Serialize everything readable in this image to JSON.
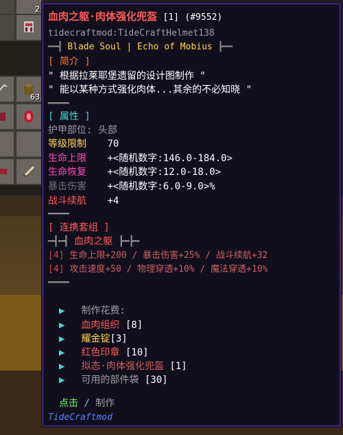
{
  "item": {
    "name": "血肉之躯·肉体强化兜盔",
    "count": "[1]",
    "id": "(#9552)",
    "registry_id": "tidecraftmod:TideCraftHelmet138",
    "series_left": "━━┫",
    "series": "Blade Soul | Echo of Mobius",
    "series_right": "┣━━"
  },
  "intro": {
    "header": "[ 简介 ]",
    "lines": [
      "\" 根据拉莱耶堡遗留的设计图制作 \"",
      "\" 能以某种方式强化肉体...其余的不必知晓 \""
    ],
    "divider": "━━━━"
  },
  "attributes": {
    "header": "[ 属性 ]",
    "slot_label": "护甲部位: 头部",
    "level_label": "等级限制",
    "level_value": "70",
    "stats": [
      {
        "label": "生命上限",
        "value": "+<随机数字:146.0-184.0>"
      },
      {
        "label": "生命恢复",
        "value": "+<随机数字:12.0-18.0>"
      },
      {
        "label": "暴击伤害",
        "value": "+<随机数字:6.0-9.0>%"
      },
      {
        "label": "战斗续航",
        "value": "+4"
      }
    ],
    "divider": "━━━━"
  },
  "set": {
    "header": "[ 连携套组 ]",
    "left": "━┫━┫",
    "name": "血肉之躯",
    "right": "┣━┣━",
    "bonus1_tag": "[4]",
    "bonus1": "生命上限+200 / 暴击伤害+25% / 战斗续航+32",
    "bonus2_tag": "[4]",
    "bonus2": "攻击速度+50 / 物理穿透+10% / 魔法穿透+10%",
    "divider": "━━━━"
  },
  "crafting": {
    "bullet": "▶",
    "header": "制作花费:",
    "items": [
      {
        "name": "血肉组织",
        "qty": "[8]"
      },
      {
        "name": "耀金锭",
        "qty": "[3]"
      },
      {
        "name": "红色印章",
        "qty": "[10]"
      },
      {
        "name": "拟态·肉体强化兜盔",
        "qty": "[1]"
      },
      {
        "name": "可用的部件袋",
        "qty": "[30]"
      }
    ],
    "action_click": "点击",
    "action_sep": " / ",
    "action_craft": "制作"
  },
  "mod_name": "TideCraftmod",
  "inventory": {
    "slot_counts": [
      "2",
      "63"
    ]
  },
  "colors": {
    "tooltip_bg": "#120f1d",
    "tooltip_border": "#4b2b8a",
    "name_red": "#ff5a5a",
    "header_cyan": "#4ad6d6",
    "level_yellow": "#ffd84a",
    "hp_pink": "#ff4db8",
    "mod_blue": "#5a7dff"
  }
}
